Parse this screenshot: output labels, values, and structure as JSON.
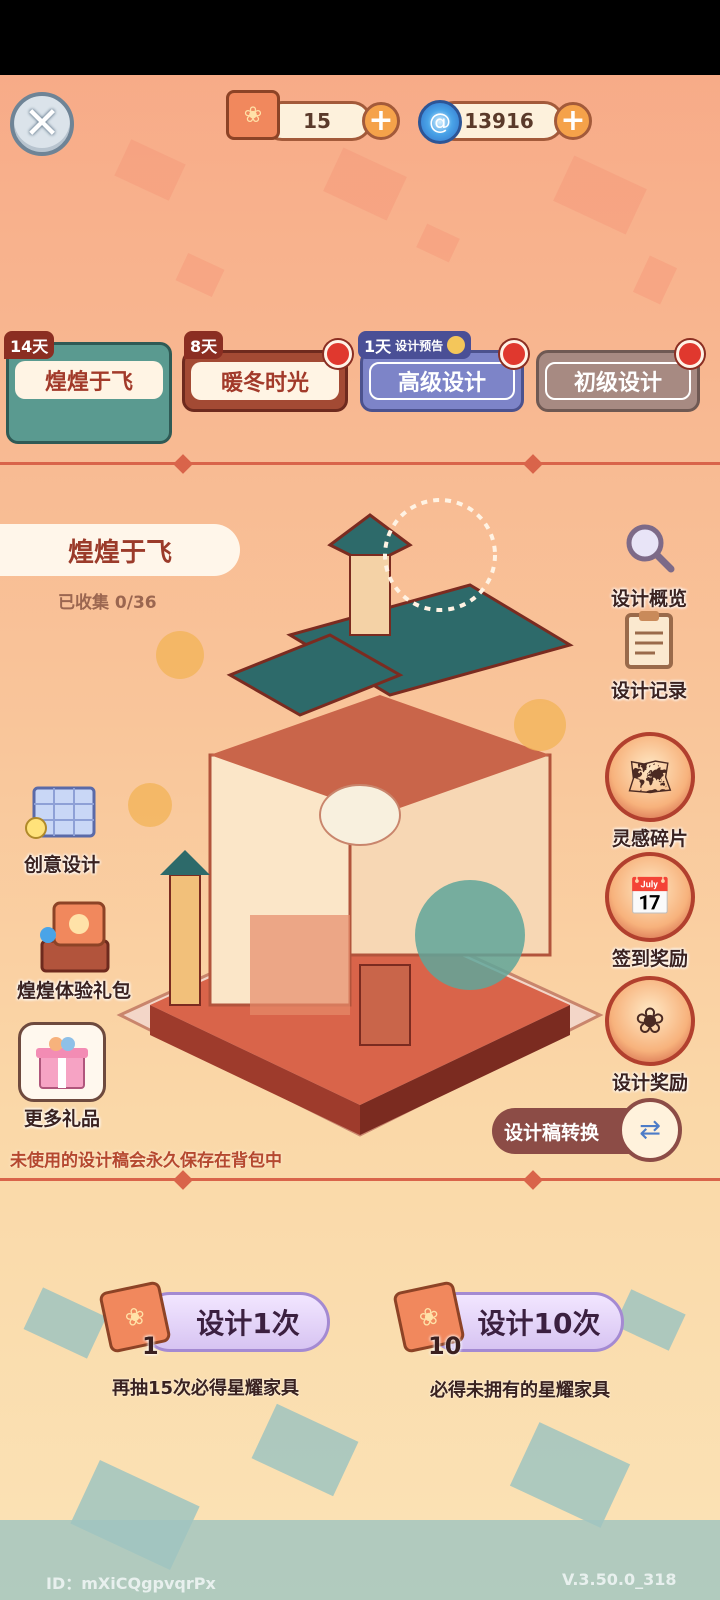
{
  "currency": {
    "design_scrolls": "15",
    "inspiration": "13916"
  },
  "tabs": [
    {
      "label": "煌煌于飞",
      "days": "14天"
    },
    {
      "label": "暖冬时光",
      "days": "8天"
    },
    {
      "label": "高级设计",
      "days": "1天",
      "preview": "设计预告"
    },
    {
      "label": "初级设计"
    }
  ],
  "set": {
    "title": "煌煌于飞",
    "collected": "已收集 0/36"
  },
  "right_menu": {
    "overview": "设计概览",
    "records": "设计记录",
    "fragments": "灵感碎片",
    "signin": "签到奖励",
    "reward": "设计奖励"
  },
  "left_menu": {
    "creative": "创意设计",
    "trial_pack": "煌煌体验礼包",
    "more_gifts": "更多礼品"
  },
  "convert_label": "设计稿转换",
  "hint": "未使用的设计稿会永久保存在背包中",
  "draw": {
    "single": {
      "label": "设计1次",
      "count": "1",
      "sub": "再抽15次必得星耀家具"
    },
    "ten": {
      "label": "设计10次",
      "count": "10",
      "sub": "必得未拥有的星耀家具"
    }
  },
  "footer": {
    "id": "ID：mXiCQgpvqrPx",
    "version": "V.3.50.0_318"
  }
}
